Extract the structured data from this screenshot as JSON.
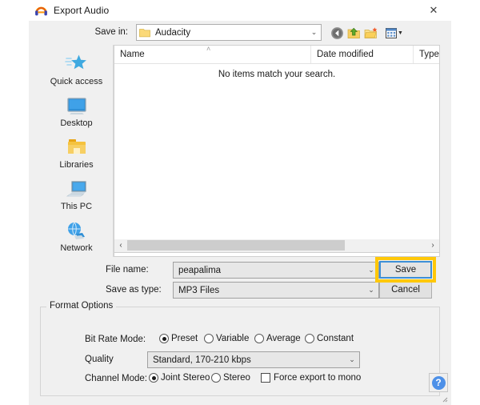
{
  "window": {
    "title": "Export Audio",
    "icon": "audacity-headphones-icon",
    "close_label": "✕"
  },
  "savein": {
    "label": "Save in:",
    "value": "Audacity",
    "arrow": "⌄",
    "toolbar": [
      {
        "name": "back-button",
        "tooltip": "Back"
      },
      {
        "name": "up-one-level-button",
        "tooltip": "Up One Level"
      },
      {
        "name": "create-new-folder-button",
        "tooltip": "Create New Folder"
      },
      {
        "name": "views-button",
        "tooltip": "Views"
      }
    ],
    "views_caret": "▼"
  },
  "places": {
    "items": [
      {
        "label": "Quick access",
        "icon": "star-icon"
      },
      {
        "label": "Desktop",
        "icon": "monitor-icon"
      },
      {
        "label": "Libraries",
        "icon": "folder-icon"
      },
      {
        "label": "This PC",
        "icon": "computer-icon"
      },
      {
        "label": "Network",
        "icon": "network-globe-icon"
      }
    ]
  },
  "filelist": {
    "columns": [
      "Name",
      "Date modified",
      "Type"
    ],
    "sort_caret": "˄",
    "empty_message": "No items match your search.",
    "rows": []
  },
  "scrollbar": {
    "left_arrow": "‹",
    "right_arrow": "›"
  },
  "fields": {
    "filename_label": "File name:",
    "filename_value": "peapalima",
    "filetype_label": "Save as type:",
    "filetype_value": "MP3 Files",
    "arrow": "⌄"
  },
  "buttons": {
    "save": "Save",
    "cancel": "Cancel"
  },
  "annotation": {
    "target": "save-button",
    "color": "#ffc80a"
  },
  "format_options": {
    "title": "Format Options",
    "bitrate_mode": {
      "label": "Bit Rate Mode:",
      "options": [
        {
          "label": "Preset",
          "selected": true
        },
        {
          "label": "Variable",
          "selected": false
        },
        {
          "label": "Average",
          "selected": false
        },
        {
          "label": "Constant",
          "selected": false
        }
      ]
    },
    "quality": {
      "label": "Quality",
      "value": "Standard, 170-210 kbps",
      "arrow": "⌄"
    },
    "channel_mode": {
      "label": "Channel Mode:",
      "options": [
        {
          "label": "Joint Stereo",
          "selected": true
        },
        {
          "label": "Stereo",
          "selected": false
        }
      ],
      "checkbox": {
        "label": "Force export to mono",
        "checked": false
      }
    },
    "help": {
      "glyph": "?",
      "name": "help-button"
    }
  }
}
